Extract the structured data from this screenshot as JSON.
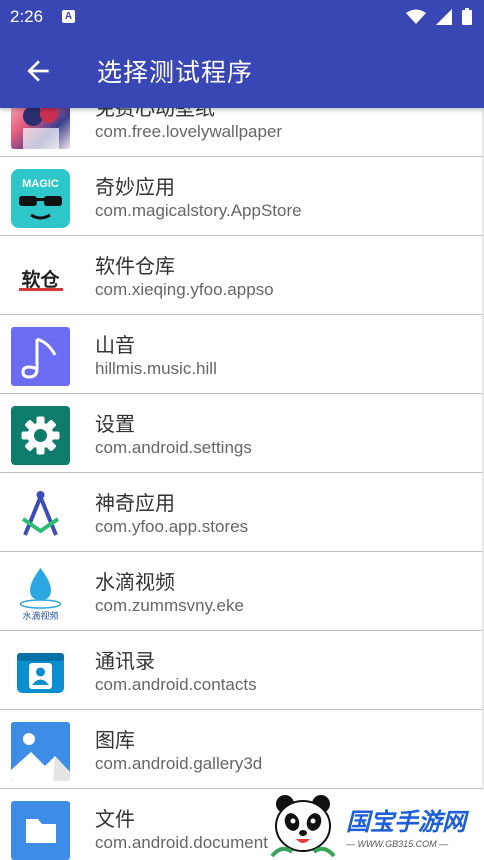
{
  "status_bar": {
    "time": "2:26",
    "notification_badge": "A"
  },
  "app_bar": {
    "title": "选择测试程序",
    "back_icon": "arrow-left-icon"
  },
  "apps": [
    {
      "name": "免费心动壁纸",
      "package": "com.free.lovelywallpaper",
      "icon": "anime-wallpaper-icon"
    },
    {
      "name": "奇妙应用",
      "package": "com.magicalstory.AppStore",
      "icon": "magic-sunglasses-icon",
      "icon_text": "MAGIC"
    },
    {
      "name": "软件仓库",
      "package": "com.xieqing.yfoo.appso",
      "icon": "software-warehouse-icon",
      "icon_text": "软仓"
    },
    {
      "name": "山音",
      "package": "hillmis.music.hill",
      "icon": "music-note-icon"
    },
    {
      "name": "设置",
      "package": "com.android.settings",
      "icon": "gear-icon"
    },
    {
      "name": "神奇应用",
      "package": "com.yfoo.app.stores",
      "icon": "compass-a-icon"
    },
    {
      "name": "水滴视频",
      "package": "com.zummsvny.eke",
      "icon": "water-drop-icon",
      "icon_text": "水滴视频"
    },
    {
      "name": "通讯录",
      "package": "com.android.contacts",
      "icon": "contacts-icon"
    },
    {
      "name": "图库",
      "package": "com.android.gallery3d",
      "icon": "gallery-icon"
    },
    {
      "name": "文件",
      "package": "com.android.documentsui",
      "icon": "folder-icon"
    }
  ],
  "watermark": {
    "title": "国宝手游网",
    "url": "— WWW.GB315.COM —"
  }
}
